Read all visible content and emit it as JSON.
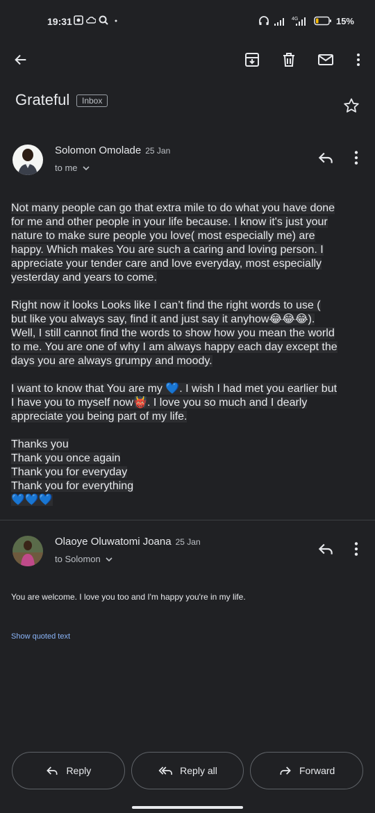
{
  "status_bar": {
    "time": "19:31",
    "battery": "15%",
    "network": "4G"
  },
  "toolbar": {
    "icons": [
      "back-arrow-icon",
      "archive-icon",
      "delete-icon",
      "mark-unread-icon",
      "more-vert-icon"
    ]
  },
  "email": {
    "subject": "Grateful",
    "label": "Inbox"
  },
  "messages": [
    {
      "sender": "Solomon Omolade",
      "date": "25 Jan",
      "recipient": "to me",
      "paragraphs": [
        [
          "Not many people can go that extra mile to do what you have done",
          "for me and other people in your life because. I know it's just your",
          "nature to make sure people you love( most especially me) are",
          "happy. Which makes You are such a caring and loving person. I",
          "appreciate your tender care and love everyday, most especially",
          "yesterday and years to come."
        ],
        [
          "Right now it looks Looks like I can’t find the right words to use (",
          "but like you always say, find it and just say it anyhow😂😂😂).",
          "Well, I still cannot find the words to show how you mean the world",
          "to me. You are one of why I am always happy each day except the",
          "days you are always grumpy and moody."
        ],
        [
          "I want to know that You are my 💙. I wish I had met you earlier but",
          "I have you to myself now👹. I love you so much and I dearly",
          "appreciate you being part of my life."
        ],
        [
          "Thanks you",
          "Thank you once again",
          "Thank you for everyday",
          "Thank you for everything",
          "💙💙💙"
        ]
      ]
    },
    {
      "sender": "Olaoye Oluwatomi Joana",
      "date": "25 Jan",
      "recipient": "to Solomon",
      "text": "You are welcome. I love you too and I'm happy you're in my life.",
      "quoted_link": "Show quoted text"
    }
  ],
  "actions": {
    "reply": "Reply",
    "reply_all": "Reply all",
    "forward": "Forward"
  },
  "colors": {
    "background": "#202124",
    "text": "#e8eaed",
    "link": "#8ab4f8"
  }
}
